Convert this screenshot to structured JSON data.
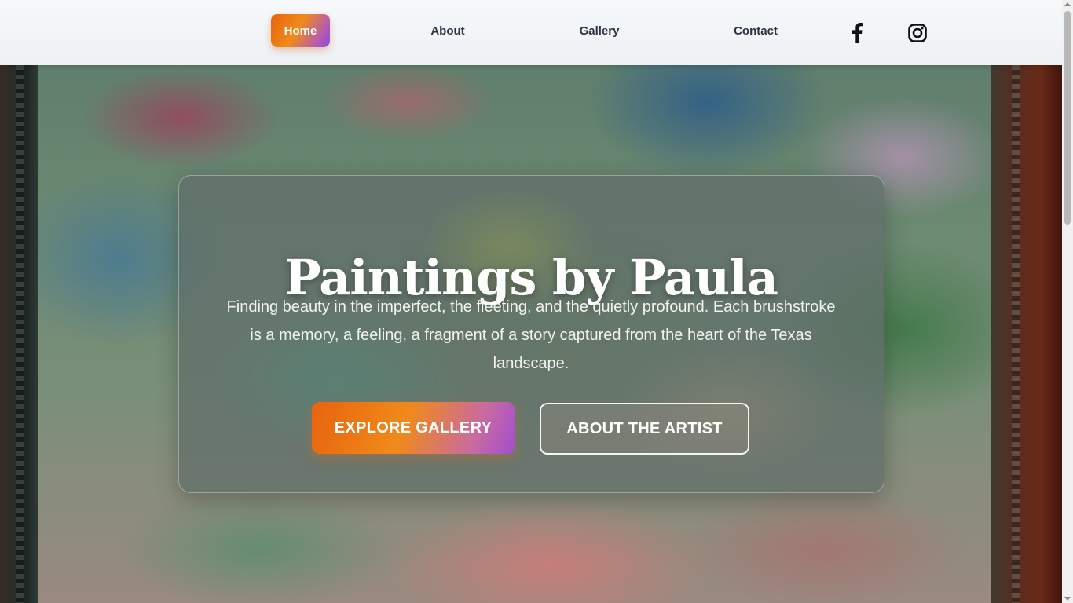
{
  "nav": {
    "items": [
      {
        "label": "Home",
        "active": true
      },
      {
        "label": "About",
        "active": false
      },
      {
        "label": "Gallery",
        "active": false
      },
      {
        "label": "Contact",
        "active": false
      }
    ],
    "social": [
      {
        "icon": "facebook-icon"
      },
      {
        "icon": "instagram-icon"
      }
    ]
  },
  "hero": {
    "title": "Paintings by Paula",
    "description": "Finding beauty in the imperfect, the fleeting, and the quietly profound. Each brushstroke is a memory, a feeling, a fragment of a story captured from the heart of the Texas landscape.",
    "buttons": {
      "primary": "EXPLORE GALLERY",
      "secondary": "ABOUT THE ARTIST"
    },
    "background": "painted-landscape-canvas"
  },
  "colors": {
    "accent_orange": "#e8630d",
    "accent_purple": "#a24ed0",
    "nav_text": "#2b3440"
  }
}
